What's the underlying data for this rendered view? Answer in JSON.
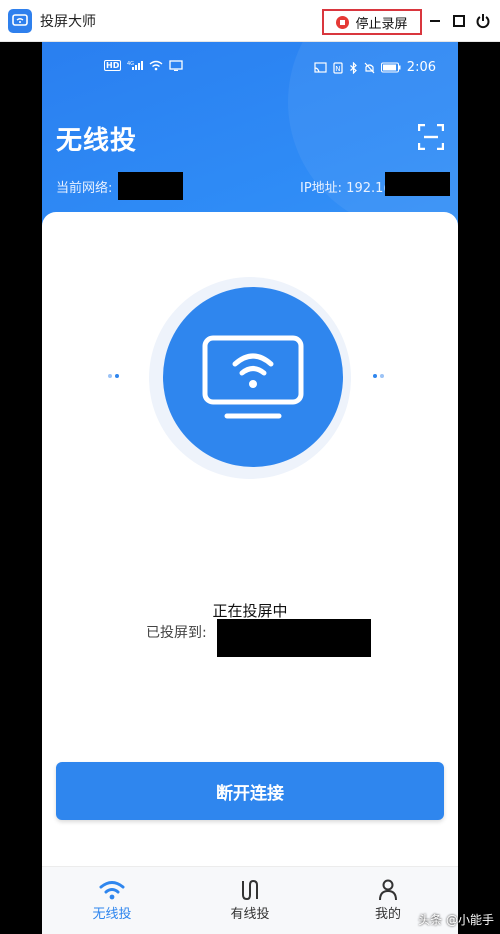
{
  "window": {
    "app_title": "投屏大师",
    "stop_recording_label": "停止录屏",
    "controls": [
      "minimize-icon",
      "maximize-icon",
      "power-icon"
    ]
  },
  "status_bar": {
    "left_icons": [
      "hd-icon",
      "signal-4g-icon",
      "wifi-icon",
      "cast-icon"
    ],
    "right_icons": [
      "screen-mirror-icon",
      "nfc-icon",
      "bluetooth-icon",
      "mute-icon",
      "battery-icon"
    ],
    "time": "2:06"
  },
  "header": {
    "title": "无线投",
    "network_label": "当前网络:",
    "ip_label": "IP地址: 192.1("
  },
  "main": {
    "casting_status": "正在投屏中",
    "cast_target_label": "已投屏到:",
    "disconnect_label": "断开连接"
  },
  "nav": {
    "items": [
      {
        "label": "无线投",
        "icon": "wifi-icon",
        "active": true
      },
      {
        "label": "有线投",
        "icon": "cable-icon",
        "active": false
      },
      {
        "label": "我的",
        "icon": "user-icon",
        "active": false
      }
    ]
  },
  "watermark": "头条 @小能手",
  "colors": {
    "primary": "#2f86ee",
    "stop_red": "#e53935",
    "highlight_border": "#d9363e"
  }
}
